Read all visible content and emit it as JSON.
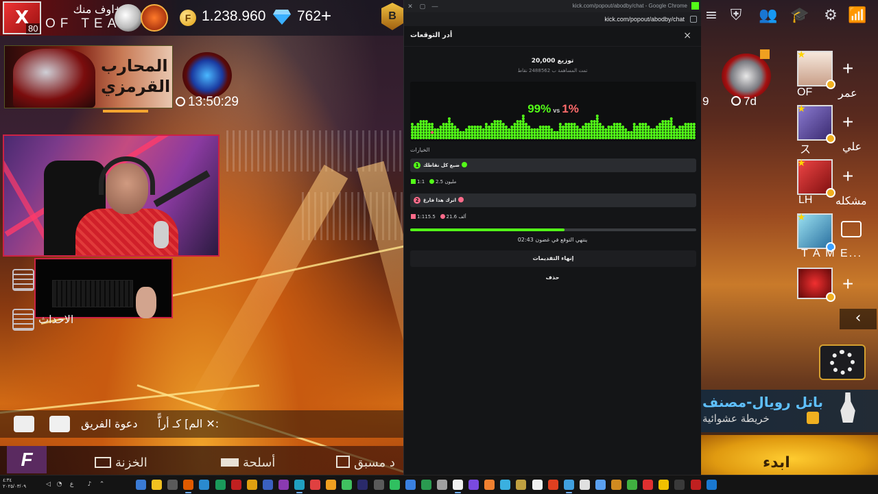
{
  "game_left": {
    "avatar_letter": "X",
    "level": "80",
    "team_top": "اوف منك+",
    "team_bottom": "OF TEAM",
    "gold": "1.238.960",
    "diamonds": "762",
    "plus": "+",
    "rank_badge": "B",
    "banner_text": "المحارب القرمزي",
    "timer": "13:50:29",
    "events_label": "الاحداث",
    "invite_label": "دعوة الفريق",
    "chat_line": "الم] كـ أراًّ ✕:",
    "menu": {
      "logo": "F",
      "vault": "الخزنة",
      "weapons": "أسلحة",
      "advanced": "د مسبق"
    }
  },
  "popup": {
    "window_title": "kick.com/popout/abodby/chat - Google Chrome",
    "url": "kick.com/popout/abodby/chat",
    "modal_title": "أدر التوقعات",
    "close": "×",
    "distribution": "توزيع 20,000",
    "contribution": "تمت المساهمة ب 2488562 نقاط",
    "percent_left": "99%",
    "vs": "vs",
    "percent_right": "1%",
    "options_label": "الخيارات",
    "options": [
      {
        "number": "1",
        "label": "ضيع كل نقاطك",
        "ratio": "1:1",
        "amount": "2.5 مليون",
        "color": "#53fc18"
      },
      {
        "number": "2",
        "label": "اترك هذا فارغ",
        "ratio": "1:115.5",
        "amount": "21.6 ألف",
        "color": "#ff6b8a"
      }
    ],
    "progress": 0.54,
    "ends_text": "02:43 ينتهي التوقع في غضون",
    "end_button": "إنهاء التقديمات",
    "delete_button": "حذف"
  },
  "game_right": {
    "timer_left": "9",
    "timer_right": "7d",
    "friends": [
      {
        "name": "عمر",
        "tag": "OF",
        "color": "#f2e0d4"
      },
      {
        "name": "علي",
        "tag": "ス",
        "color": "#6a5aa8"
      },
      {
        "name": "مشكله",
        "tag": "LH",
        "color": "#c82020"
      },
      {
        "name": "",
        "tag": "T A M E...",
        "color": "#5ab8d8"
      },
      {
        "name": "",
        "tag": "",
        "color": "#c8101a"
      }
    ],
    "mode_title": "باتل رويال-مصنف",
    "mode_sub": "خريطة عشوائية",
    "yellow_text": "ابدء"
  },
  "taskbar": {
    "time": "٤:٣٤",
    "date": "٢٠٢٥/٠٣/٠٩",
    "lang": "ع"
  }
}
